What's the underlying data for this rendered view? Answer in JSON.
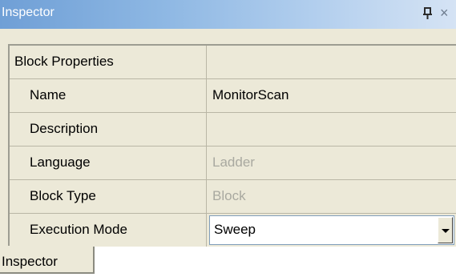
{
  "window": {
    "title": "Inspector",
    "pin_glyph": "ᵖ",
    "close_glyph": "×"
  },
  "properties": {
    "category": "Block Properties",
    "rows": [
      {
        "name": "Name",
        "value": "MonitorScan"
      },
      {
        "name": "Description",
        "value": ""
      },
      {
        "name": "Language",
        "value": "Ladder"
      },
      {
        "name": "Block Type",
        "value": "Block"
      },
      {
        "name": "Execution Mode",
        "value": "Sweep"
      }
    ]
  },
  "tabs": [
    {
      "label": "Inspector"
    }
  ]
}
